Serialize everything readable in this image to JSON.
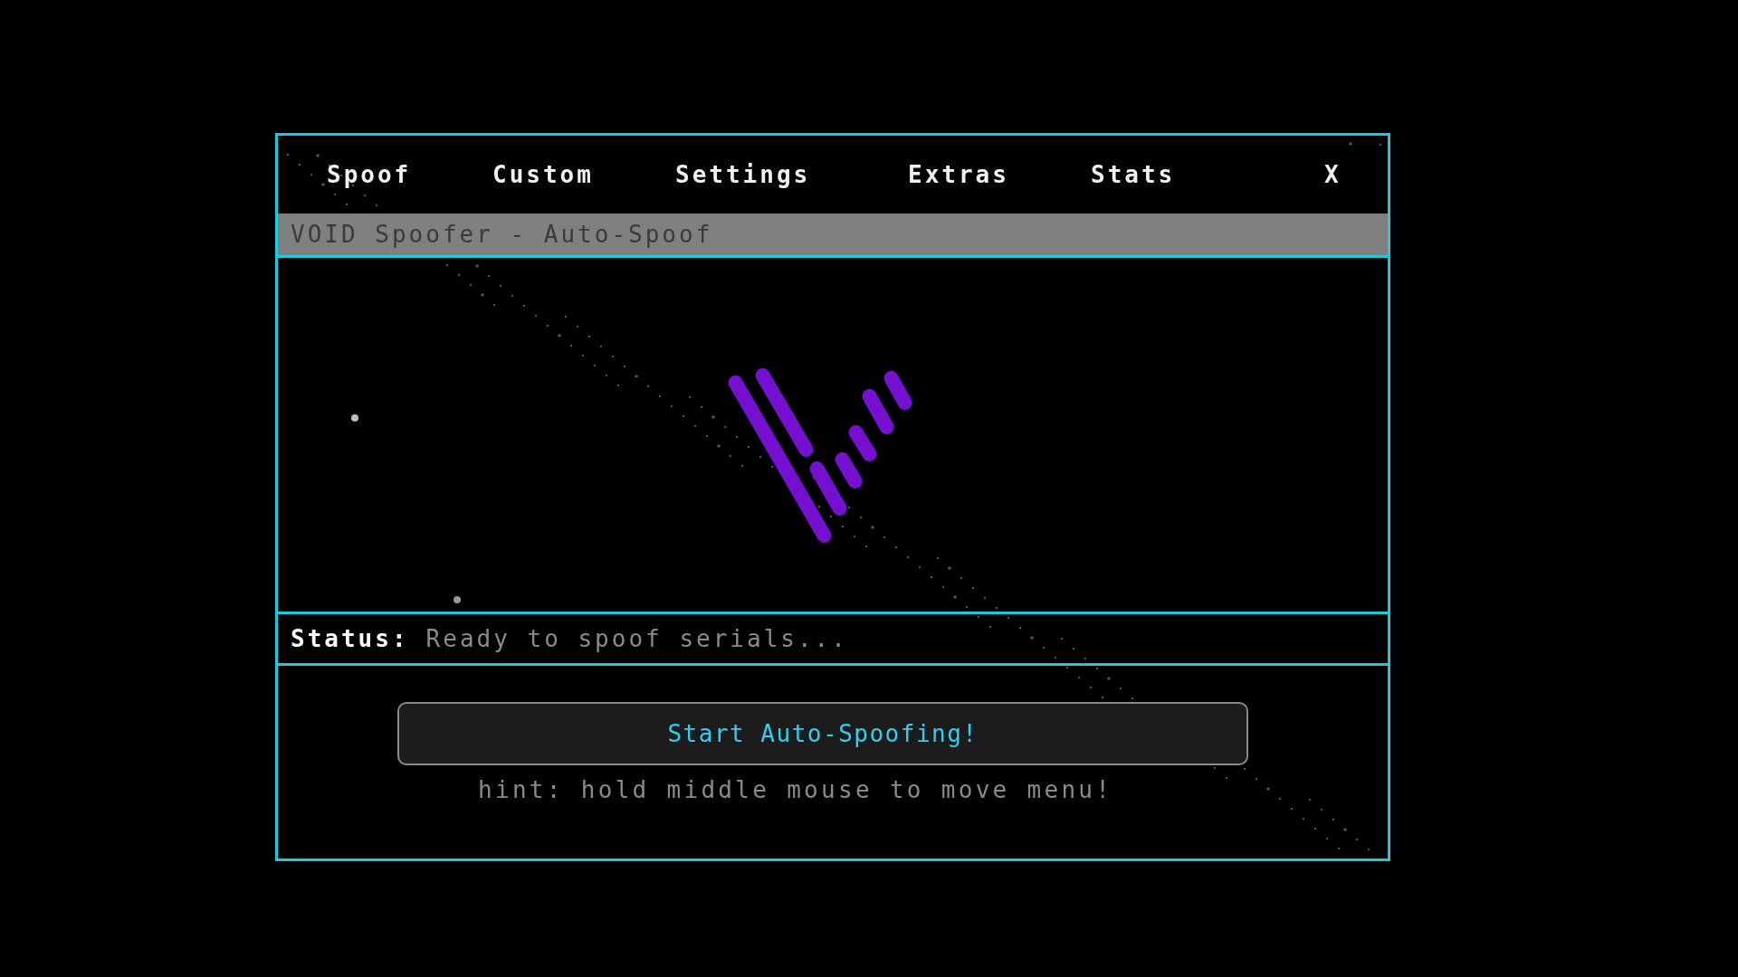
{
  "tabs": [
    {
      "label": "Spoof"
    },
    {
      "label": "Custom"
    },
    {
      "label": "Settings"
    },
    {
      "label": "Extras"
    },
    {
      "label": "Stats"
    }
  ],
  "close": "X",
  "title": "VOID Spoofer - Auto-Spoof",
  "status": {
    "label": "Status:",
    "text": "Ready to spoof serials..."
  },
  "button": "Start Auto-Spoofing!",
  "hint": "hint: hold middle mouse to move menu!"
}
